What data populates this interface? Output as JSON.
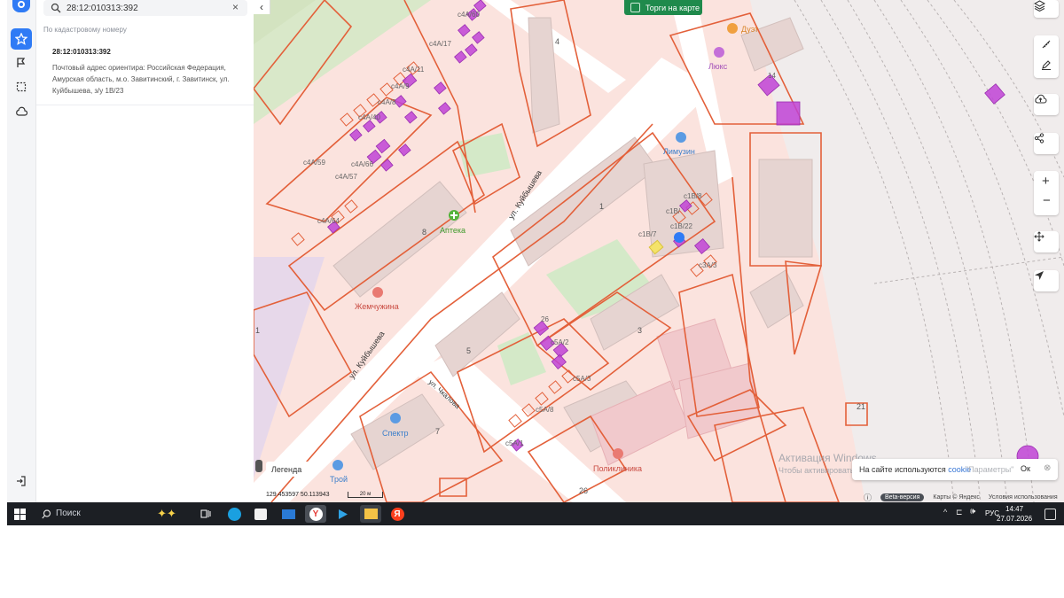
{
  "search": {
    "value": "28:12:010313:392",
    "section_label": "По кадастровому номеру"
  },
  "result": {
    "title": "28:12:010313:392",
    "address": "Почтовый адрес ориентира: Российская Федерация, Амурская область, м.о. Завитинский, г. Завитинск, ул. Куйбышева, з/у 1В/23"
  },
  "rail": {
    "icons": [
      "favorites-star-icon",
      "flag-icon",
      "selection-frame-icon",
      "cloud-icon",
      "logout-icon"
    ]
  },
  "map": {
    "torgi_label": "Торги на карте",
    "legend_label": "Легенда",
    "coords": "129.453597   50.113943",
    "scale_label": "20 м",
    "poi": {
      "apteka": "Аптека",
      "zhemchuzhina": "Жемчужина",
      "limuzin": "Лимузин",
      "lyuks": "Люкс",
      "duet": "Дуэт",
      "spektr": "Спектр",
      "poliklinika": "Поликлиника",
      "troy": "Трой"
    },
    "streets": {
      "kuibysheva_1": "ул. Куйбышева",
      "kuibysheva_2": "ул. Куйбышева",
      "chkalova": "ул. Чкалова"
    },
    "house_numbers": [
      "4",
      "8",
      "1",
      "3",
      "5",
      "7",
      "26",
      "21",
      "1"
    ],
    "parcel_labels": [
      "с4А/60",
      "с4А/17",
      "с4А/11",
      "с4А/9",
      "с4А/8",
      "с4А/40",
      "с4А/59",
      "с4А/66",
      "с4А/57",
      "с4А/64",
      "с1В/8",
      "с1В/",
      "с1В/7",
      "с1В/22",
      "с3А/3",
      "с5А/2",
      "с5А/3",
      "с5А/8",
      "с5А/1",
      "26",
      "14"
    ],
    "watermark_title": "Активация Windows",
    "watermark_sub": "Чтобы активировать",
    "cookie_text": "На сайте используются",
    "cookie_link": "cookie",
    "cookie_ok": "Ок",
    "watermark_tail": "\"Параметры\"",
    "beta_label": "Beta-версия",
    "attribution": "Карты © Яндекс",
    "terms": "Условия использования",
    "right_controls": [
      "layers-icon",
      "ruler-icon",
      "edit-icon",
      "cloud-upload-icon",
      "share-icon",
      "zoom-in-icon",
      "zoom-out-icon",
      "move-icon",
      "locate-icon"
    ]
  },
  "taskbar": {
    "search_label": "Поиск",
    "lang": "РУС",
    "time": "14:47",
    "date": "27.07.2026"
  },
  "colors": {
    "boundary": "#e3603a",
    "parcel_magenta": "#c043d6",
    "map_bg": "#fbe3de",
    "park_green": "#dcebd0",
    "torgi_green": "#1f8a4c",
    "accent_blue": "#2f7bf5"
  }
}
